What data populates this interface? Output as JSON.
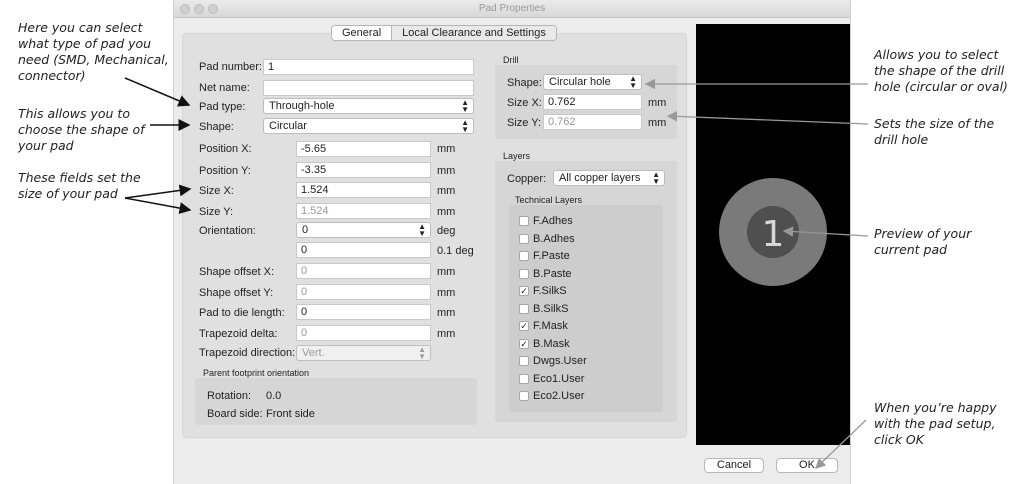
{
  "window": {
    "title": "Pad Properties"
  },
  "tabs": [
    {
      "label": "General"
    },
    {
      "label": "Local Clearance and Settings"
    }
  ],
  "pad": {
    "pad_number_label": "Pad number:",
    "pad_number": "1",
    "net_name_label": "Net name:",
    "net_name": "",
    "pad_type_label": "Pad type:",
    "pad_type": "Through-hole",
    "shape_label": "Shape:",
    "shape": "Circular",
    "pos_x_label": "Position X:",
    "pos_x": "-5.65",
    "pos_x_unit": "mm",
    "pos_y_label": "Position Y:",
    "pos_y": "-3.35",
    "pos_y_unit": "mm",
    "size_x_label": "Size X:",
    "size_x": "1.524",
    "size_x_unit": "mm",
    "size_y_label": "Size Y:",
    "size_y": "1.524",
    "size_y_unit": "mm",
    "orientation_label": "Orientation:",
    "orientation": "0",
    "orientation_unit": "deg",
    "orientation_fine": "0",
    "orientation_fine_unit": "0.1 deg",
    "offset_x_label": "Shape offset X:",
    "offset_x": "0",
    "offset_x_unit": "mm",
    "offset_y_label": "Shape offset Y:",
    "offset_y": "0",
    "offset_y_unit": "mm",
    "die_label": "Pad to die length:",
    "die": "0",
    "die_unit": "mm",
    "trap_delta_label": "Trapezoid delta:",
    "trap_delta": "0",
    "trap_delta_unit": "mm",
    "trap_dir_label": "Trapezoid direction:",
    "trap_dir": "Vert."
  },
  "parent": {
    "title": "Parent footprint orientation",
    "rotation_label": "Rotation:",
    "rotation": "0.0",
    "side_label": "Board side:",
    "side": "Front side"
  },
  "drill": {
    "title": "Drill",
    "shape_label": "Shape:",
    "shape": "Circular hole",
    "size_x_label": "Size X:",
    "size_x": "0.762",
    "size_x_unit": "mm",
    "size_y_label": "Size Y:",
    "size_y": "0.762",
    "size_y_unit": "mm"
  },
  "layers": {
    "title": "Layers",
    "copper_label": "Copper:",
    "copper": "All copper layers",
    "technical_title": "Technical Layers",
    "items": [
      {
        "label": "F.Adhes",
        "checked": false
      },
      {
        "label": "B.Adhes",
        "checked": false
      },
      {
        "label": "F.Paste",
        "checked": false
      },
      {
        "label": "B.Paste",
        "checked": false
      },
      {
        "label": "F.SilkS",
        "checked": true
      },
      {
        "label": "B.SilkS",
        "checked": false
      },
      {
        "label": "F.Mask",
        "checked": true
      },
      {
        "label": "B.Mask",
        "checked": true
      },
      {
        "label": "Dwgs.User",
        "checked": false
      },
      {
        "label": "Eco1.User",
        "checked": false
      },
      {
        "label": "Eco2.User",
        "checked": false
      }
    ]
  },
  "preview": {
    "pad_label": "1"
  },
  "buttons": {
    "cancel": "Cancel",
    "ok": "OK"
  },
  "annotations": {
    "pad_type": "Here you can select what type of pad you need (SMD, Mechanical, connector)",
    "shape": "This allows you to choose the shape of your pad",
    "size": "These fields set the size of your pad",
    "drill_shape": "Allows you to select the shape of the drill hole (circular or oval)",
    "drill_size": "Sets the size of the drill hole",
    "preview": "Preview of your current pad",
    "ok": "When you’re happy with the pad setup, click OK"
  },
  "colors": {
    "preview_bg": "#000000",
    "pad_outer": "#7a7a7a",
    "pad_inner": "#4f4f4f"
  }
}
